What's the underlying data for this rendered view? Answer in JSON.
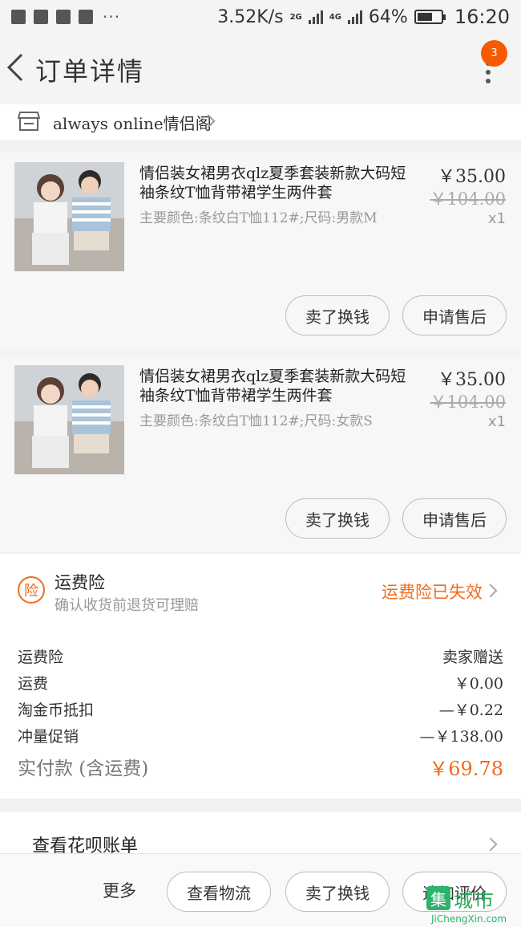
{
  "status_bar": {
    "net_speed": "3.52K/s",
    "net_2g": "2G",
    "net_4g": "4G",
    "battery": "64%",
    "time": "16:20",
    "more": "···"
  },
  "header": {
    "title": "订单详情",
    "badge_count": "3"
  },
  "shop": {
    "name": "always online情侣阁"
  },
  "items": [
    {
      "title": "情侣装女裙男衣qlz夏季套装新款大码短袖条纹T恤背带裙学生两件套",
      "spec": "主要颜色:条纹白T恤112#;尺码:男款M",
      "price": "￥35.00",
      "original_price": "￥104.00",
      "quantity": "x1",
      "sell_label": "卖了换钱",
      "after_sale_label": "申请售后"
    },
    {
      "title": "情侣装女裙男衣qlz夏季套装新款大码短袖条纹T恤背带裙学生两件套",
      "spec": "主要颜色:条纹白T恤112#;尺码:女款S",
      "price": "￥35.00",
      "original_price": "￥104.00",
      "quantity": "x1",
      "sell_label": "卖了换钱",
      "after_sale_label": "申请售后"
    }
  ],
  "insurance": {
    "icon_char": "险",
    "title": "运费险",
    "subtitle": "确认收货前退货可理赔",
    "status": "运费险已失效"
  },
  "summary": {
    "rows": [
      {
        "label": "运费险",
        "value": "卖家赠送"
      },
      {
        "label": "运费",
        "value": "￥0.00"
      },
      {
        "label": "淘金币抵扣",
        "value": "—￥0.22"
      },
      {
        "label": "冲量促销",
        "value": "—￥138.00"
      }
    ],
    "total_label": "实付款 (含运费)",
    "total_value": "￥69.78"
  },
  "huabei": {
    "label": "查看花呗账单"
  },
  "bottom_bar": {
    "more_label": "更多",
    "logistics_label": "查看物流",
    "sell_label": "卖了换钱",
    "review_label": "追加评价"
  },
  "watermark": {
    "logo_char": "集",
    "text": "城市",
    "url": "JiChengXin.com"
  },
  "colors": {
    "accent": "#f26b1d",
    "badge": "#f55a00",
    "watermark": "#2eb36d"
  }
}
